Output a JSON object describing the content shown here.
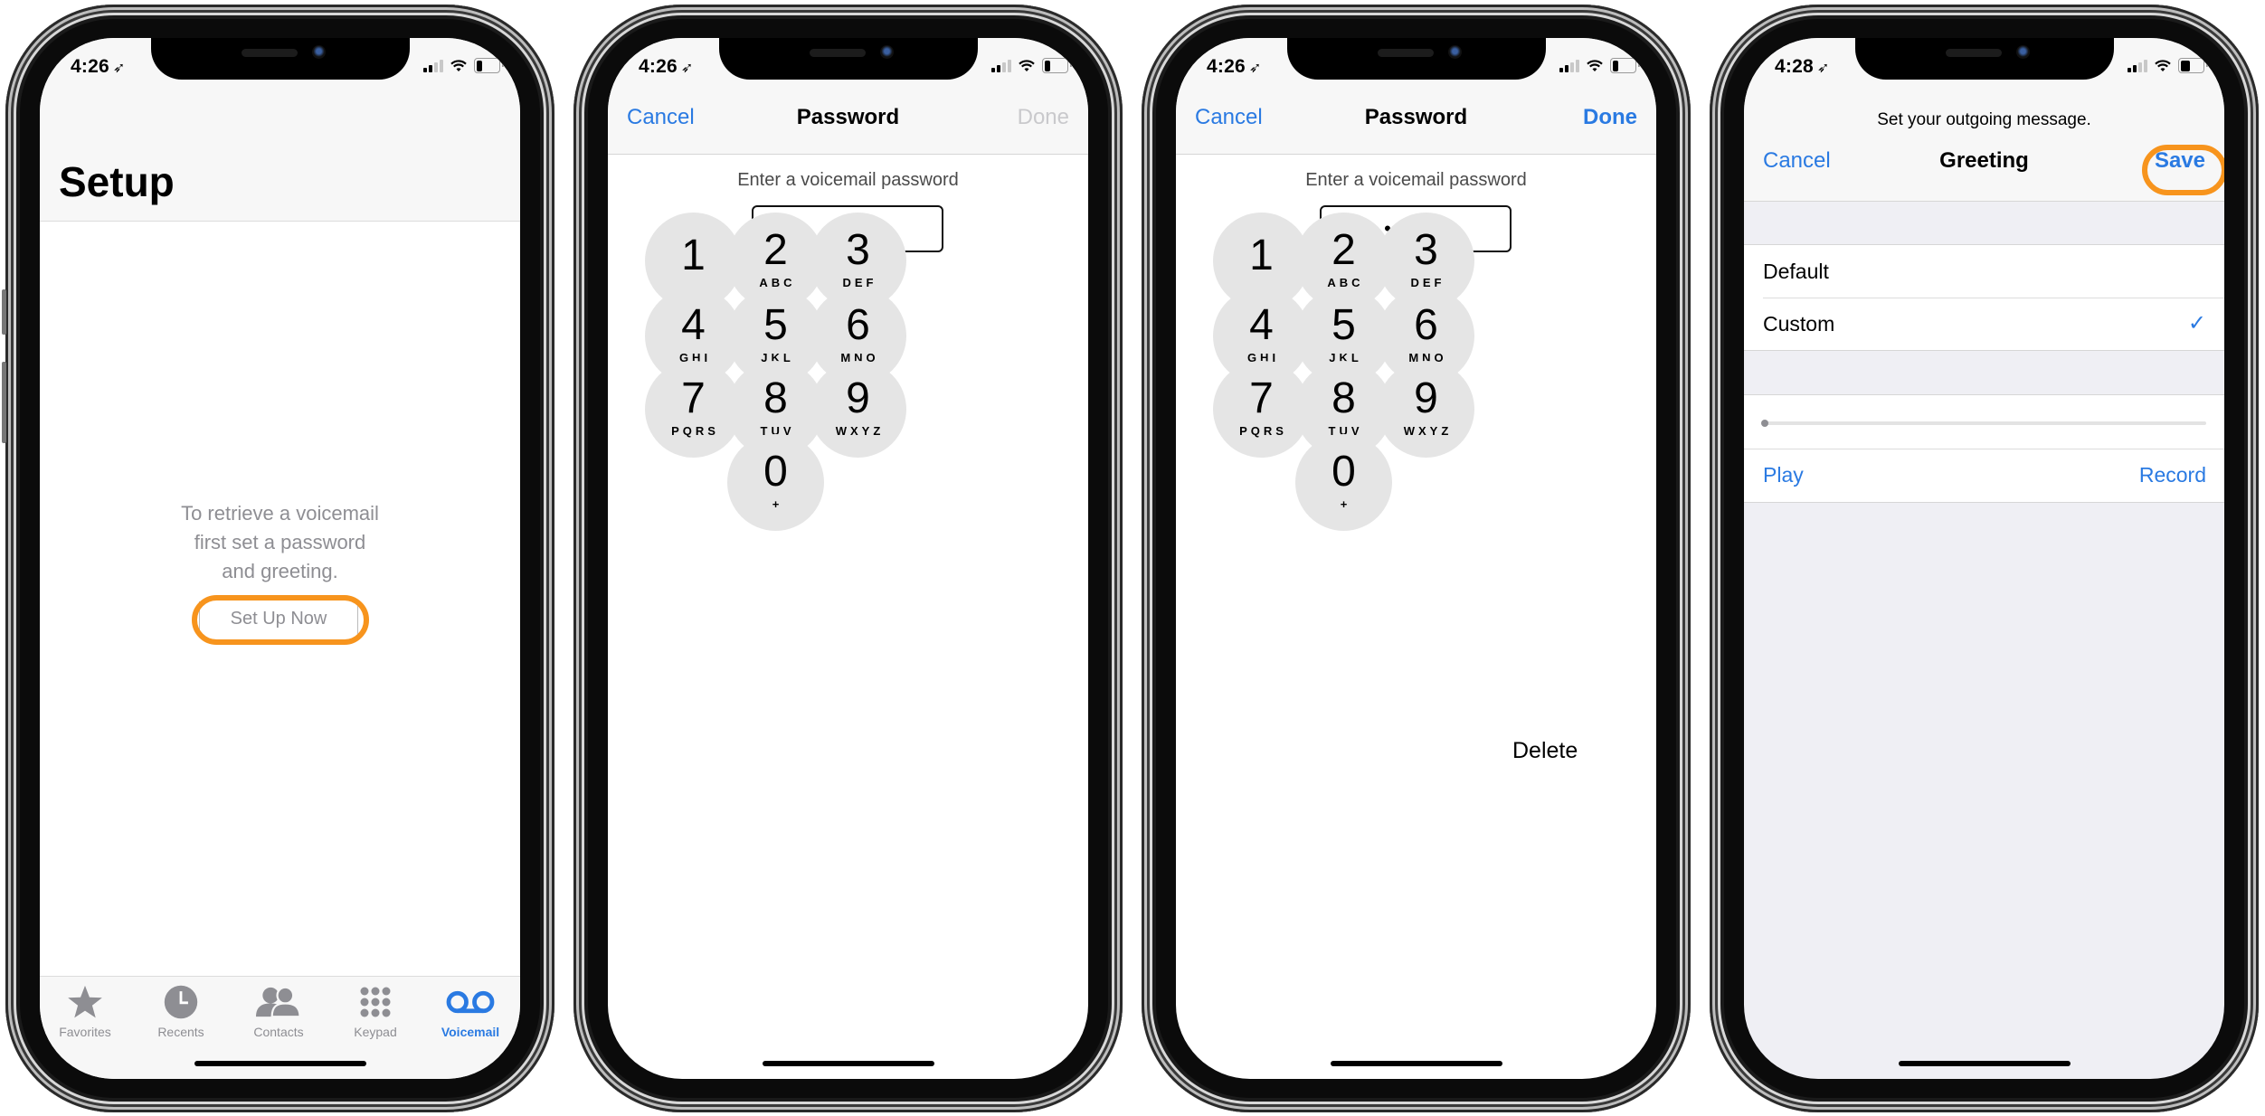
{
  "accent_color": "#2a7ae2",
  "highlight_color": "#f7941d",
  "phones": [
    {
      "status": {
        "time": "4:26",
        "signal_bars": 2,
        "signal_total": 4,
        "battery_level": 0.25
      },
      "screen": "voicemail-setup",
      "title": "Setup",
      "message_lines": [
        "To retrieve a voicemail",
        "first set a password",
        "and greeting."
      ],
      "setup_button": "Set Up Now",
      "tabs": [
        {
          "label": "Favorites",
          "icon": "star-icon",
          "active": false
        },
        {
          "label": "Recents",
          "icon": "clock-icon",
          "active": false
        },
        {
          "label": "Contacts",
          "icon": "contacts-icon",
          "active": false
        },
        {
          "label": "Keypad",
          "icon": "keypad-icon",
          "active": false
        },
        {
          "label": "Voicemail",
          "icon": "voicemail-icon",
          "active": true
        }
      ]
    },
    {
      "status": {
        "time": "4:26",
        "signal_bars": 2,
        "signal_total": 4,
        "battery_level": 0.25
      },
      "screen": "password-empty",
      "nav": {
        "left": "Cancel",
        "title": "Password",
        "right": "Done",
        "right_enabled": false
      },
      "prompt": "Enter a voicemail password",
      "field_value": "",
      "keys": [
        {
          "digit": "1",
          "letters": ""
        },
        {
          "digit": "2",
          "letters": "ABC"
        },
        {
          "digit": "3",
          "letters": "DEF"
        },
        {
          "digit": "4",
          "letters": "GHI"
        },
        {
          "digit": "5",
          "letters": "JKL"
        },
        {
          "digit": "6",
          "letters": "MNO"
        },
        {
          "digit": "7",
          "letters": "PQRS"
        },
        {
          "digit": "8",
          "letters": "TUV"
        },
        {
          "digit": "9",
          "letters": "WXYZ"
        },
        {
          "digit": "0",
          "letters": "+"
        }
      ]
    },
    {
      "status": {
        "time": "4:26",
        "signal_bars": 2,
        "signal_total": 4,
        "battery_level": 0.25
      },
      "screen": "password-entered",
      "nav": {
        "left": "Cancel",
        "title": "Password",
        "right": "Done",
        "right_enabled": true
      },
      "prompt": "Enter a voicemail password",
      "field_value": "••••",
      "delete_label": "Delete"
    },
    {
      "status": {
        "time": "4:28",
        "signal_bars": 2,
        "signal_total": 4,
        "battery_level": 0.45
      },
      "screen": "greeting",
      "prompt": "Set your outgoing message.",
      "nav": {
        "left": "Cancel",
        "title": "Greeting",
        "right": "Save"
      },
      "options": [
        {
          "label": "Default",
          "selected": false
        },
        {
          "label": "Custom",
          "selected": true
        }
      ],
      "playback_progress": 0,
      "play_label": "Play",
      "record_label": "Record"
    }
  ]
}
